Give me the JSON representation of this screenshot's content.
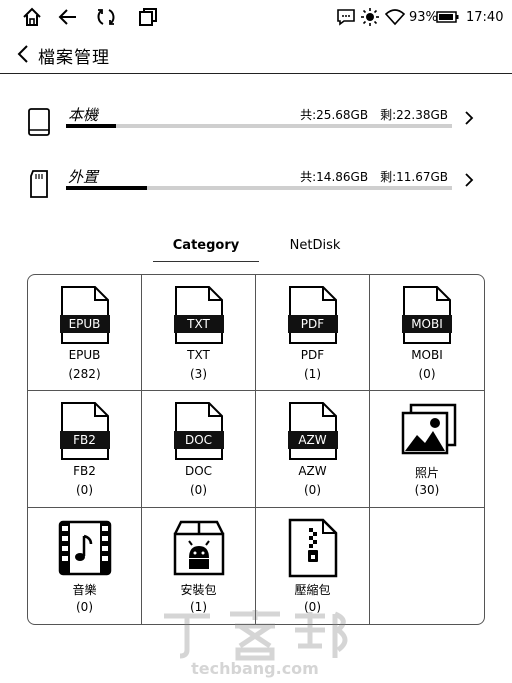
{
  "status_bar": {
    "battery": "93%",
    "time": "17:40"
  },
  "header": {
    "title": "檔案管理"
  },
  "storage": [
    {
      "name": "本機",
      "total": "共:25.68GB",
      "remaining": "剩:22.38GB",
      "used_fraction": 0.13
    },
    {
      "name": "外置",
      "total": "共:14.86GB",
      "remaining": "剩:11.67GB",
      "used_fraction": 0.21
    }
  ],
  "tabs": [
    {
      "label": "Category",
      "active": true
    },
    {
      "label": "NetDisk",
      "active": false
    }
  ],
  "categories": [
    {
      "tag": "EPUB",
      "label": "EPUB",
      "count": "(282)",
      "icon": "epub-file-icon"
    },
    {
      "tag": "TXT",
      "label": "TXT",
      "count": "(3)",
      "icon": "txt-file-icon"
    },
    {
      "tag": "PDF",
      "label": "PDF",
      "count": "(1)",
      "icon": "pdf-file-icon"
    },
    {
      "tag": "MOBI",
      "label": "MOBI",
      "count": "(0)",
      "icon": "mobi-file-icon"
    },
    {
      "tag": "FB2",
      "label": "FB2",
      "count": "(0)",
      "icon": "fb2-file-icon"
    },
    {
      "tag": "DOC",
      "label": "DOC",
      "count": "(0)",
      "icon": "doc-file-icon"
    },
    {
      "tag": "AZW",
      "label": "AZW",
      "count": "(0)",
      "icon": "azw-file-icon"
    },
    {
      "tag": "",
      "label": "照片",
      "count": "(30)",
      "icon": "photos-icon"
    },
    {
      "tag": "",
      "label": "音樂",
      "count": "(0)",
      "icon": "music-icon"
    },
    {
      "tag": "",
      "label": "安裝包",
      "count": "(1)",
      "icon": "android-package-icon"
    },
    {
      "tag": "",
      "label": "壓縮包",
      "count": "(0)",
      "icon": "zip-archive-icon"
    }
  ],
  "watermark": {
    "logo_text": "T客邦",
    "site": "techbang.com"
  }
}
